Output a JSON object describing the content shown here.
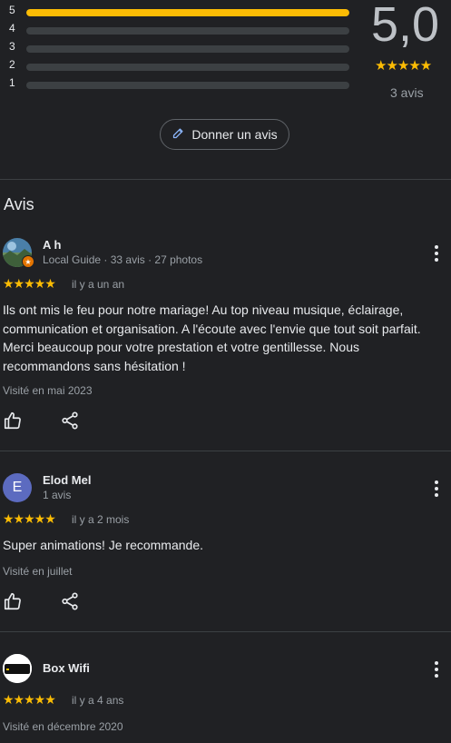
{
  "rating": {
    "histogram": [
      {
        "stars": "5",
        "fraction": 1.0
      },
      {
        "stars": "4",
        "fraction": 0.0
      },
      {
        "stars": "3",
        "fraction": 0.0
      },
      {
        "stars": "2",
        "fraction": 0.0
      },
      {
        "stars": "1",
        "fraction": 0.0
      }
    ],
    "score": "5,0",
    "stars": "★★★★★",
    "count": "3 avis",
    "accent_color": "#fbbc04"
  },
  "write_review": {
    "label": "Donner un avis",
    "icon": "pencil-icon"
  },
  "reviews_section": {
    "title": "Avis"
  },
  "reviews": [
    {
      "author": "A h",
      "meta": "Local Guide · 33 avis · 27 photos",
      "stars": "★★★★★",
      "when": "il y a un an",
      "text": "Ils ont mis le feu pour notre mariage! Au top niveau musique, éclairage, communication et organisation. A l'écoute avec l'envie que tout soit parfait. Merci beaucoup pour votre prestation et votre gentillesse. Nous recommandons sans hésitation !",
      "visited": "Visité en mai 2023"
    },
    {
      "author": "Elod Mel",
      "meta": "1 avis",
      "avatar_letter": "E",
      "avatar_color": "#5c6bc0",
      "stars": "★★★★★",
      "when": "il y a 2 mois",
      "text": "Super animations! Je recommande.",
      "visited": "Visité en juillet"
    },
    {
      "author": "Box Wifi",
      "stars": "★★★★★",
      "when": "il y a 4 ans",
      "visited": "Visité en décembre 2020"
    }
  ]
}
